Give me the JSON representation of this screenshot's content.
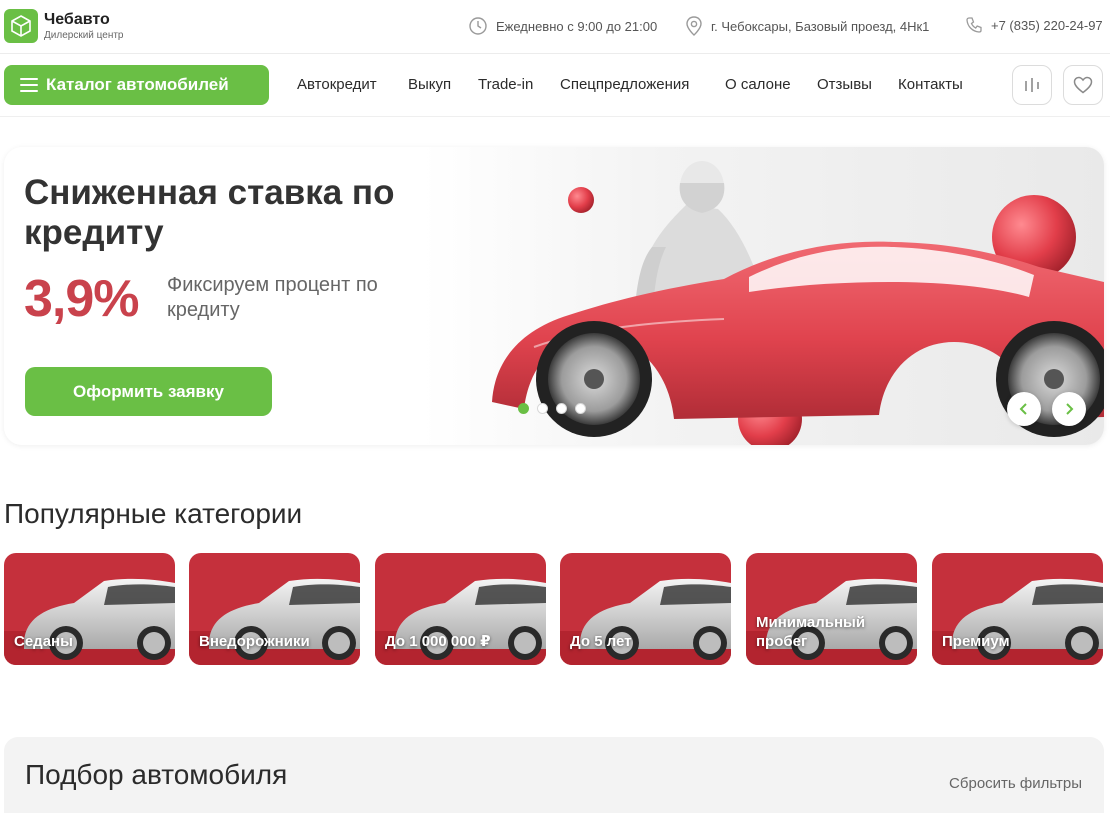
{
  "header": {
    "brand_name": "Чебавто",
    "brand_sub": "Дилерский центр",
    "hours": "Ежедневно с 9:00 до 21:00",
    "address": "г. Чебоксары, Базовый проезд, 4Нк1",
    "phone": "+7 (835) 220-24-97"
  },
  "nav": {
    "catalog_label": "Каталог автомобилей",
    "links": [
      "Автокредит",
      "Выкуп",
      "Trade-in",
      "Спецпредложения",
      "О салоне",
      "Отзывы",
      "Контакты"
    ]
  },
  "hero": {
    "title": "Сниженная ставка по кредиту",
    "rate": "3,9%",
    "description": "Фиксируем процент по кредиту",
    "cta": "Оформить заявку",
    "slide_count": 4,
    "active_slide": 1
  },
  "categories": {
    "title": "Популярные категории",
    "items": [
      {
        "label": "Седаны"
      },
      {
        "label": "Внедорожники"
      },
      {
        "label": "До 1 000 000 ₽"
      },
      {
        "label": "До 5 лет"
      },
      {
        "label": "Минимальный пробег"
      },
      {
        "label": "Премиум"
      }
    ]
  },
  "filter": {
    "title": "Подбор автомобиля",
    "reset_label": "Сбросить фильтры"
  },
  "colors": {
    "accent_green": "#6abf45",
    "promo_red": "#c9424c",
    "category_red": "#c5303c"
  },
  "icons": {
    "logo": "cube-logo-icon",
    "hours": "clock-icon",
    "address": "map-pin-icon",
    "phone": "phone-icon",
    "catalog": "menu-burger-icon",
    "compare": "compare-bars-icon",
    "favorites": "heart-icon",
    "prev": "chevron-left-icon",
    "next": "chevron-right-icon"
  }
}
